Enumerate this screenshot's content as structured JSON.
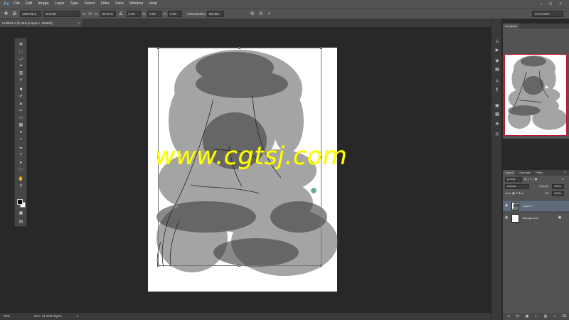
{
  "app": {
    "logo": "Ps"
  },
  "menu": [
    "File",
    "Edit",
    "Image",
    "Layer",
    "Type",
    "Select",
    "Filter",
    "View",
    "Window",
    "Help"
  ],
  "options": {
    "x_value": "1226.98 p",
    "blend_mode": "Normal",
    "pct_label": "%",
    "h_label": "H:",
    "h_value": "90.92%",
    "angle_value": "0.00",
    "hs_label": "H:",
    "hs_value": "0.00",
    "v_label": "V:",
    "v_value": "0.00",
    "interp_label": "Interpolation:",
    "interp_value": "Bicubic",
    "workspace": "Essentials"
  },
  "document_tab": {
    "title": "Untitled-1 @ 25% (Layer 1, RGB/8)",
    "close": "×"
  },
  "watermark": "www.cgtsj.com",
  "status": {
    "zoom": "25%",
    "doc": "Doc: 24.1M/0 bytes",
    "arrow": "▸"
  },
  "navigator": {
    "tab": "Navigator"
  },
  "layers_panel": {
    "tabs": [
      "Layers",
      "Channels",
      "Paths"
    ],
    "kind_label": "ρ Kind",
    "blend": "Normal",
    "opacity_label": "Opacity:",
    "opacity_value": "100%",
    "lock_label": "Lock:",
    "fill_label": "Fill:",
    "fill_value": "100%",
    "layers": [
      {
        "name": "Layer 1",
        "selected": true
      },
      {
        "name": "Background",
        "selected": false,
        "locked": true
      }
    ]
  },
  "colors": {
    "accent_nav_frame": "#c8102e",
    "watermark": "#ffff00",
    "selected_layer": "#5f6a7a"
  }
}
